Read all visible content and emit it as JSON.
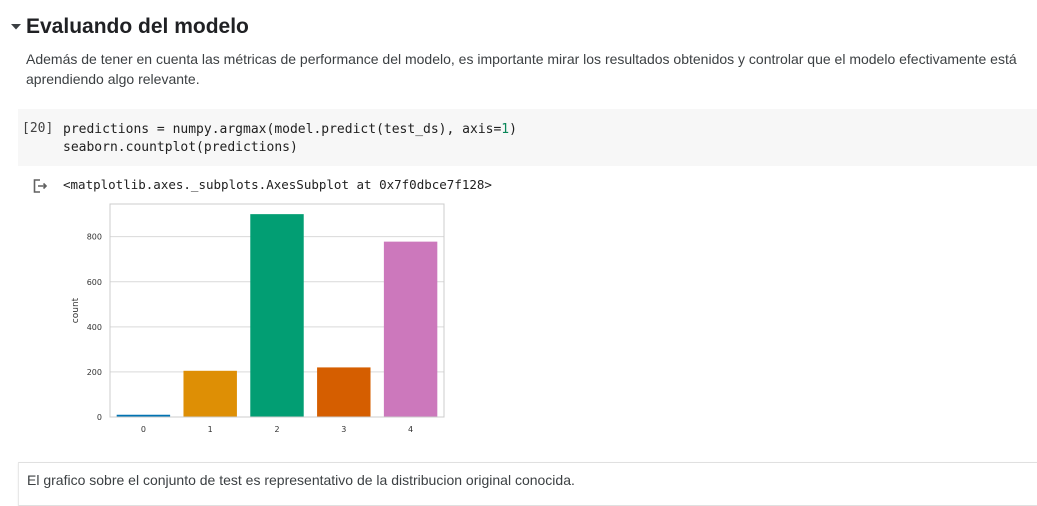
{
  "section": {
    "title": "Evaluando del modelo",
    "description": "Además de tener en cuenta las métricas de performance del modelo, es importante mirar los resultados obtenidos y controlar que el modelo efectivamente está aprendiendo algo relevante."
  },
  "code_cell": {
    "execution_count": "[20]",
    "line1_a": "predictions = numpy.argmax(model.predict(test_ds), axis=",
    "line1_num": "1",
    "line1_b": ")",
    "line2": "seaborn.countplot(predictions)"
  },
  "output": {
    "repr": "<matplotlib.axes._subplots.AxesSubplot at 0x7f0dbce7f128>",
    "icon": "output-redirect-icon"
  },
  "chart_data": {
    "type": "bar",
    "categories": [
      "0",
      "1",
      "2",
      "3",
      "4"
    ],
    "values": [
      10,
      205,
      900,
      220,
      778
    ],
    "colors": [
      "#0173b2",
      "#de8f05",
      "#029e73",
      "#d55e00",
      "#cc78bc"
    ],
    "ylabel": "count",
    "xlabel": "",
    "ylim": [
      0,
      945
    ],
    "yticks": [
      0,
      200,
      400,
      600,
      800
    ],
    "grid": true
  },
  "markdown_cell": {
    "text": "El grafico sobre el conjunto de test es representativo de la distribucion original conocida."
  }
}
